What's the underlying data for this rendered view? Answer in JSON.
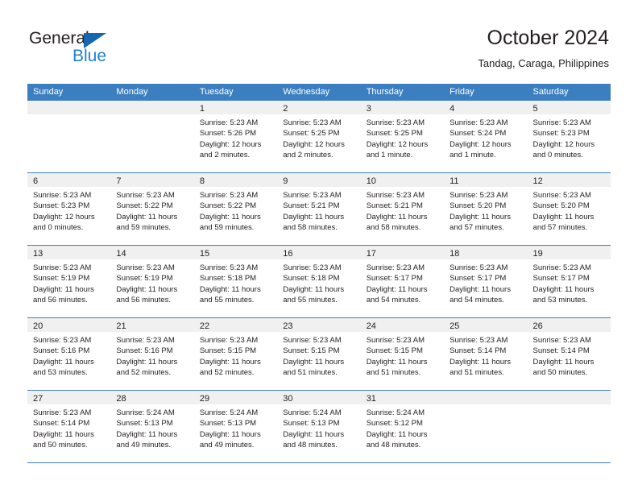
{
  "brand": {
    "name_top": "General",
    "name_bottom": "Blue",
    "triangle_color": "#1666b0",
    "blue_text_color": "#1f7fd0"
  },
  "header": {
    "title": "October 2024",
    "subtitle": "Tandag, Caraga, Philippines"
  },
  "theme": {
    "header_blue": "#3c7fc0",
    "date_strip_gray": "#f0f0f0",
    "text_color": "#231f20"
  },
  "weekdays": [
    "Sunday",
    "Monday",
    "Tuesday",
    "Wednesday",
    "Thursday",
    "Friday",
    "Saturday"
  ],
  "weeks": [
    [
      {
        "day": "",
        "empty": true,
        "sunrise": "",
        "sunset": "",
        "daylight_1": "",
        "daylight_2": ""
      },
      {
        "day": "",
        "empty": true,
        "sunrise": "",
        "sunset": "",
        "daylight_1": "",
        "daylight_2": ""
      },
      {
        "day": "1",
        "empty": false,
        "sunrise": "Sunrise: 5:23 AM",
        "sunset": "Sunset: 5:26 PM",
        "daylight_1": "Daylight: 12 hours",
        "daylight_2": "and 2 minutes."
      },
      {
        "day": "2",
        "empty": false,
        "sunrise": "Sunrise: 5:23 AM",
        "sunset": "Sunset: 5:25 PM",
        "daylight_1": "Daylight: 12 hours",
        "daylight_2": "and 2 minutes."
      },
      {
        "day": "3",
        "empty": false,
        "sunrise": "Sunrise: 5:23 AM",
        "sunset": "Sunset: 5:25 PM",
        "daylight_1": "Daylight: 12 hours",
        "daylight_2": "and 1 minute."
      },
      {
        "day": "4",
        "empty": false,
        "sunrise": "Sunrise: 5:23 AM",
        "sunset": "Sunset: 5:24 PM",
        "daylight_1": "Daylight: 12 hours",
        "daylight_2": "and 1 minute."
      },
      {
        "day": "5",
        "empty": false,
        "sunrise": "Sunrise: 5:23 AM",
        "sunset": "Sunset: 5:23 PM",
        "daylight_1": "Daylight: 12 hours",
        "daylight_2": "and 0 minutes."
      }
    ],
    [
      {
        "day": "6",
        "empty": false,
        "sunrise": "Sunrise: 5:23 AM",
        "sunset": "Sunset: 5:23 PM",
        "daylight_1": "Daylight: 12 hours",
        "daylight_2": "and 0 minutes."
      },
      {
        "day": "7",
        "empty": false,
        "sunrise": "Sunrise: 5:23 AM",
        "sunset": "Sunset: 5:22 PM",
        "daylight_1": "Daylight: 11 hours",
        "daylight_2": "and 59 minutes."
      },
      {
        "day": "8",
        "empty": false,
        "sunrise": "Sunrise: 5:23 AM",
        "sunset": "Sunset: 5:22 PM",
        "daylight_1": "Daylight: 11 hours",
        "daylight_2": "and 59 minutes."
      },
      {
        "day": "9",
        "empty": false,
        "sunrise": "Sunrise: 5:23 AM",
        "sunset": "Sunset: 5:21 PM",
        "daylight_1": "Daylight: 11 hours",
        "daylight_2": "and 58 minutes."
      },
      {
        "day": "10",
        "empty": false,
        "sunrise": "Sunrise: 5:23 AM",
        "sunset": "Sunset: 5:21 PM",
        "daylight_1": "Daylight: 11 hours",
        "daylight_2": "and 58 minutes."
      },
      {
        "day": "11",
        "empty": false,
        "sunrise": "Sunrise: 5:23 AM",
        "sunset": "Sunset: 5:20 PM",
        "daylight_1": "Daylight: 11 hours",
        "daylight_2": "and 57 minutes."
      },
      {
        "day": "12",
        "empty": false,
        "sunrise": "Sunrise: 5:23 AM",
        "sunset": "Sunset: 5:20 PM",
        "daylight_1": "Daylight: 11 hours",
        "daylight_2": "and 57 minutes."
      }
    ],
    [
      {
        "day": "13",
        "empty": false,
        "sunrise": "Sunrise: 5:23 AM",
        "sunset": "Sunset: 5:19 PM",
        "daylight_1": "Daylight: 11 hours",
        "daylight_2": "and 56 minutes."
      },
      {
        "day": "14",
        "empty": false,
        "sunrise": "Sunrise: 5:23 AM",
        "sunset": "Sunset: 5:19 PM",
        "daylight_1": "Daylight: 11 hours",
        "daylight_2": "and 56 minutes."
      },
      {
        "day": "15",
        "empty": false,
        "sunrise": "Sunrise: 5:23 AM",
        "sunset": "Sunset: 5:18 PM",
        "daylight_1": "Daylight: 11 hours",
        "daylight_2": "and 55 minutes."
      },
      {
        "day": "16",
        "empty": false,
        "sunrise": "Sunrise: 5:23 AM",
        "sunset": "Sunset: 5:18 PM",
        "daylight_1": "Daylight: 11 hours",
        "daylight_2": "and 55 minutes."
      },
      {
        "day": "17",
        "empty": false,
        "sunrise": "Sunrise: 5:23 AM",
        "sunset": "Sunset: 5:17 PM",
        "daylight_1": "Daylight: 11 hours",
        "daylight_2": "and 54 minutes."
      },
      {
        "day": "18",
        "empty": false,
        "sunrise": "Sunrise: 5:23 AM",
        "sunset": "Sunset: 5:17 PM",
        "daylight_1": "Daylight: 11 hours",
        "daylight_2": "and 54 minutes."
      },
      {
        "day": "19",
        "empty": false,
        "sunrise": "Sunrise: 5:23 AM",
        "sunset": "Sunset: 5:17 PM",
        "daylight_1": "Daylight: 11 hours",
        "daylight_2": "and 53 minutes."
      }
    ],
    [
      {
        "day": "20",
        "empty": false,
        "sunrise": "Sunrise: 5:23 AM",
        "sunset": "Sunset: 5:16 PM",
        "daylight_1": "Daylight: 11 hours",
        "daylight_2": "and 53 minutes."
      },
      {
        "day": "21",
        "empty": false,
        "sunrise": "Sunrise: 5:23 AM",
        "sunset": "Sunset: 5:16 PM",
        "daylight_1": "Daylight: 11 hours",
        "daylight_2": "and 52 minutes."
      },
      {
        "day": "22",
        "empty": false,
        "sunrise": "Sunrise: 5:23 AM",
        "sunset": "Sunset: 5:15 PM",
        "daylight_1": "Daylight: 11 hours",
        "daylight_2": "and 52 minutes."
      },
      {
        "day": "23",
        "empty": false,
        "sunrise": "Sunrise: 5:23 AM",
        "sunset": "Sunset: 5:15 PM",
        "daylight_1": "Daylight: 11 hours",
        "daylight_2": "and 51 minutes."
      },
      {
        "day": "24",
        "empty": false,
        "sunrise": "Sunrise: 5:23 AM",
        "sunset": "Sunset: 5:15 PM",
        "daylight_1": "Daylight: 11 hours",
        "daylight_2": "and 51 minutes."
      },
      {
        "day": "25",
        "empty": false,
        "sunrise": "Sunrise: 5:23 AM",
        "sunset": "Sunset: 5:14 PM",
        "daylight_1": "Daylight: 11 hours",
        "daylight_2": "and 51 minutes."
      },
      {
        "day": "26",
        "empty": false,
        "sunrise": "Sunrise: 5:23 AM",
        "sunset": "Sunset: 5:14 PM",
        "daylight_1": "Daylight: 11 hours",
        "daylight_2": "and 50 minutes."
      }
    ],
    [
      {
        "day": "27",
        "empty": false,
        "sunrise": "Sunrise: 5:23 AM",
        "sunset": "Sunset: 5:14 PM",
        "daylight_1": "Daylight: 11 hours",
        "daylight_2": "and 50 minutes."
      },
      {
        "day": "28",
        "empty": false,
        "sunrise": "Sunrise: 5:24 AM",
        "sunset": "Sunset: 5:13 PM",
        "daylight_1": "Daylight: 11 hours",
        "daylight_2": "and 49 minutes."
      },
      {
        "day": "29",
        "empty": false,
        "sunrise": "Sunrise: 5:24 AM",
        "sunset": "Sunset: 5:13 PM",
        "daylight_1": "Daylight: 11 hours",
        "daylight_2": "and 49 minutes."
      },
      {
        "day": "30",
        "empty": false,
        "sunrise": "Sunrise: 5:24 AM",
        "sunset": "Sunset: 5:13 PM",
        "daylight_1": "Daylight: 11 hours",
        "daylight_2": "and 48 minutes."
      },
      {
        "day": "31",
        "empty": false,
        "sunrise": "Sunrise: 5:24 AM",
        "sunset": "Sunset: 5:12 PM",
        "daylight_1": "Daylight: 11 hours",
        "daylight_2": "and 48 minutes."
      },
      {
        "day": "",
        "empty": true,
        "sunrise": "",
        "sunset": "",
        "daylight_1": "",
        "daylight_2": ""
      },
      {
        "day": "",
        "empty": true,
        "sunrise": "",
        "sunset": "",
        "daylight_1": "",
        "daylight_2": ""
      }
    ]
  ]
}
